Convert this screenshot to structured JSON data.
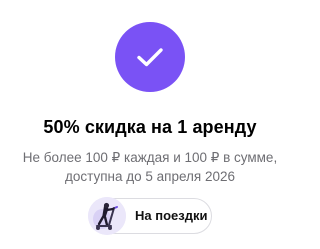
{
  "success": {
    "icon": "checkmark-icon",
    "color": "#7a52f5"
  },
  "title": "50% скидка на 1 аренду",
  "subtitle": {
    "line1": "Не более 100 ₽ каждая и 100 ₽ в сумме,",
    "line2": "доступна до 5 апреля 2026"
  },
  "cta": {
    "label": "На поездки",
    "icon": "scooter-rider-icon"
  }
}
